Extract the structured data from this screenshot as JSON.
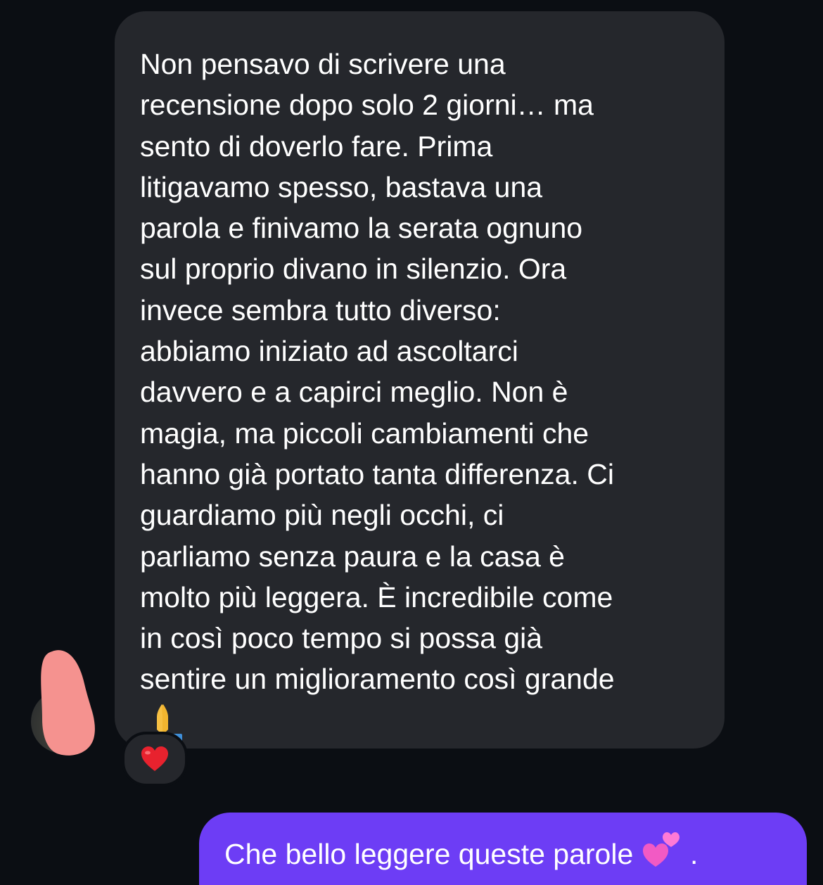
{
  "conversation": {
    "incoming_message": {
      "text": "Non pensavo di scrivere una\nrecensione dopo solo 2 giorni… ma\nsento di doverlo fare. Prima\nlitigavamo spesso, bastava una\nparola e finivamo la serata ognuno\nsul proprio divano in silenzio. Ora\ninvece sembra tutto diverso:\nabbiamo iniziato ad ascoltarci\ndavvero e a capirci meglio. Non è\nmagia, ma piccoli cambiamenti che\nhanno già portato tanta differenza. Ci\nguardiamo più negli occhi, ci\nparliamo senza paura e la casa è\nmolto più leggera. È incredibile come\nin così poco tempo si possa già\nsentire un miglioramento così grande",
      "emoji": "folded-hands-emoji",
      "reaction": "red-heart-emoji"
    },
    "outgoing_message": {
      "line1_text": "Che bello leggere queste parole",
      "line1_emoji": "two-hearts-emoji",
      "line1_suffix": " ."
    }
  },
  "colors": {
    "background": "#0b0e13",
    "incoming_bubble": "#25272c",
    "outgoing_bubble": "#6d3df5",
    "redaction": "#f5928f"
  }
}
